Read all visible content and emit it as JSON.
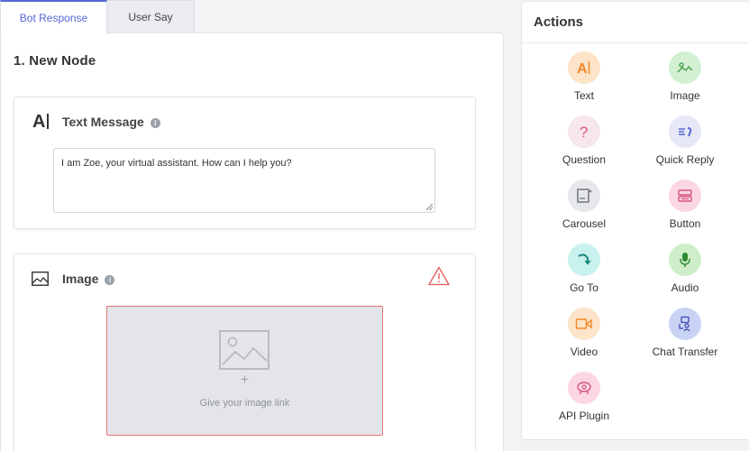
{
  "tabs": [
    {
      "label": "Bot Response"
    },
    {
      "label": "User Say"
    }
  ],
  "node": {
    "title": "1.  New Node"
  },
  "text_card": {
    "icon": "A",
    "title": "Text Message",
    "message": "I am Zoe, your virtual assistant. How can I help you?"
  },
  "image_card": {
    "title": "Image",
    "plus": "+",
    "hint": "Give your image link"
  },
  "actions": {
    "header": "Actions",
    "items": [
      {
        "label": "Text",
        "icon": "text-icon",
        "color": "#fde3c8"
      },
      {
        "label": "Image",
        "icon": "image-icon",
        "color": "#d3f0d3"
      },
      {
        "label": "Question",
        "icon": "question-icon",
        "color": "#f7e6ec"
      },
      {
        "label": "Quick Reply",
        "icon": "quick-reply-icon",
        "color": "#e6e8f8"
      },
      {
        "label": "Carousel",
        "icon": "carousel-icon",
        "color": "#e6e7ea"
      },
      {
        "label": "Button",
        "icon": "button-icon",
        "color": "#fbd7e2"
      },
      {
        "label": "Go To",
        "icon": "goto-icon",
        "color": "#c8f2ee"
      },
      {
        "label": "Audio",
        "icon": "audio-icon",
        "color": "#cdeec9"
      },
      {
        "label": "Video",
        "icon": "video-icon",
        "color": "#fde3c8"
      },
      {
        "label": "Chat Transfer",
        "icon": "chat-transfer-icon",
        "color": "#c9d3f5"
      },
      {
        "label": "API Plugin",
        "icon": "api-plugin-icon",
        "color": "#fbd7e2"
      }
    ]
  },
  "colors": {
    "accent": "#5567d5",
    "error": "#e57373"
  }
}
